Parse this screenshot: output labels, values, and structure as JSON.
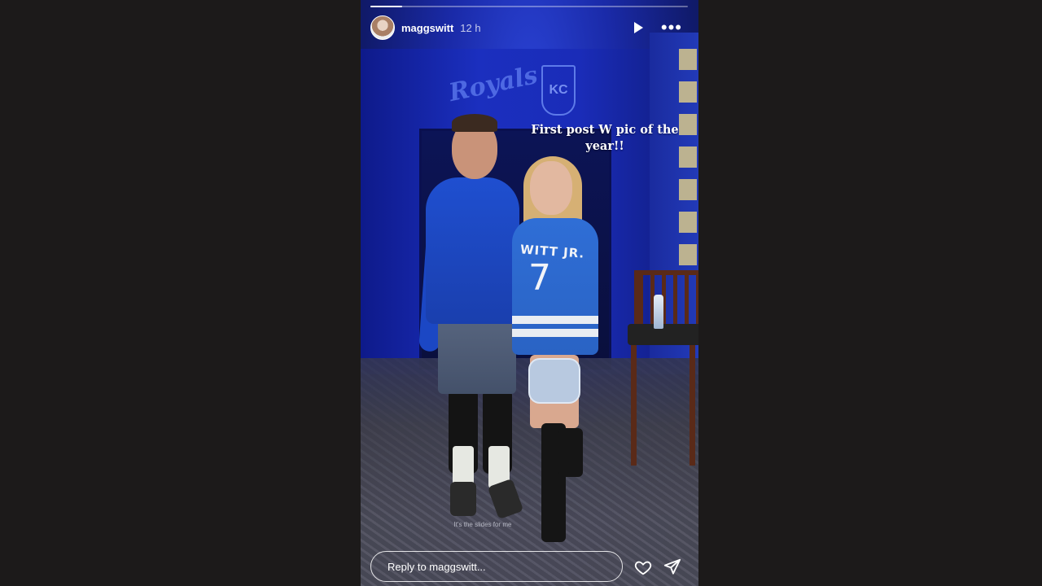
{
  "story": {
    "username": "maggswitt",
    "time": "12 h",
    "progress": 0.1,
    "caption": "First post W pic of the year!!",
    "subtext": "It's the slides for me",
    "jersey": {
      "name": "WITT JR.",
      "number": "7"
    },
    "wall_logo": "Royals",
    "wall_crest": "KC"
  },
  "controls": {
    "play_icon": "play-icon",
    "more_icon": "more-icon",
    "heart_icon": "heart-icon",
    "send_icon": "send-icon"
  },
  "reply": {
    "placeholder": "Reply to maggswitt..."
  }
}
